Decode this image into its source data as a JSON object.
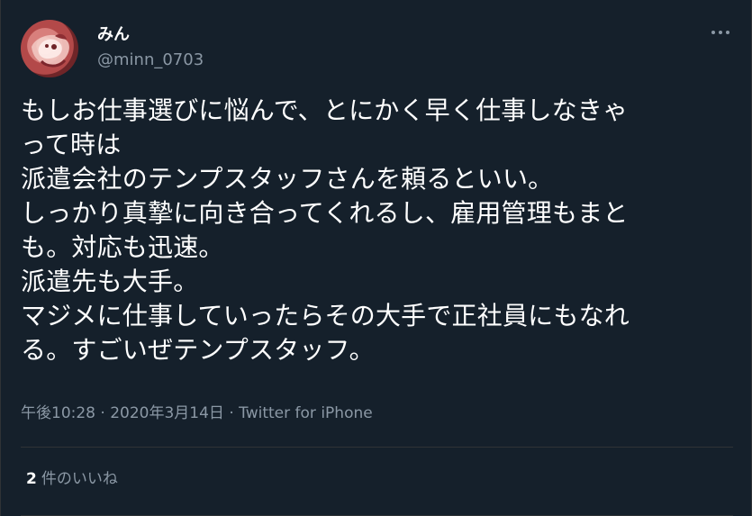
{
  "tweet": {
    "user": {
      "display_name": "みん",
      "username": "@minn_0703"
    },
    "lines": [
      "もしお仕事選びに悩んで、とにかく早く仕事しなきゃ",
      "って時は",
      "派遣会社のテンプスタッフさんを頼るといい。",
      "しっかり真摯に向き合ってくれるし、雇用管理もまと",
      "も。対応も迅速。",
      "派遣先も大手。",
      "マジメに仕事していったらその大手で正社員にもなれ",
      "る。すごいぜテンプスタッフ。"
    ],
    "time": "午後10:28",
    "separator_1": " · ",
    "date": "2020年3月14日",
    "separator_2": " · ",
    "client": "Twitter for iPhone",
    "likes_count": "2",
    "likes_label": "件のいいね"
  },
  "icons": {
    "more": "more-horizontal-icon"
  },
  "colors": {
    "background": "#15202b",
    "text_primary": "#ffffff",
    "text_secondary": "#8b98a5",
    "divider": "#2f3336"
  }
}
